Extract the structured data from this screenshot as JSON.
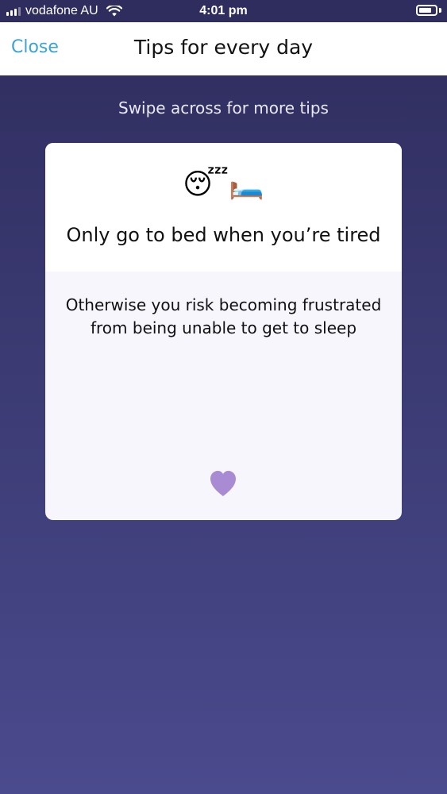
{
  "status_bar": {
    "carrier": "vodafone AU",
    "time": "4:01 pm",
    "battery_level": 0.7
  },
  "nav": {
    "close_label": "Close",
    "title": "Tips for every day"
  },
  "swipe_hint": "Swipe across for more tips",
  "tip": {
    "emoji": "😴🛏️",
    "title": "Only go to bed when you’re tired",
    "body": "Otherwise you risk becoming frustrated from being unable to get to sleep"
  },
  "colors": {
    "accent": "#3ba3d6",
    "heart": "#a98bd3",
    "background_top": "#2f2d5e",
    "background_bottom": "#4a4a8e"
  },
  "icons": {
    "favorite": "heart-icon"
  }
}
